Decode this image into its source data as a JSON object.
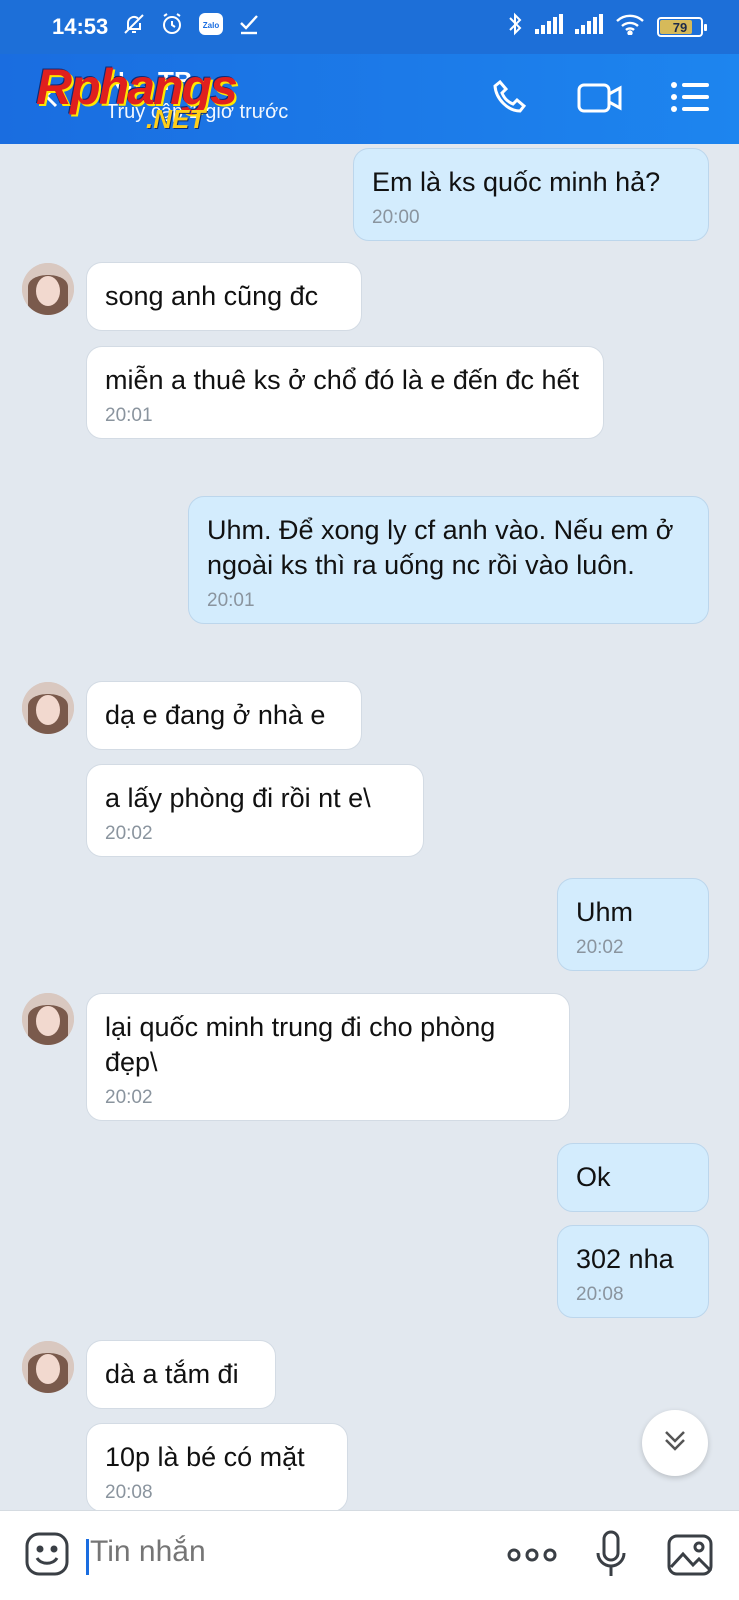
{
  "status_bar": {
    "time": "14:53",
    "battery": "79",
    "battery_level_percent": 79,
    "icons": [
      "bell-off-icon",
      "alarm-icon",
      "zalo-icon",
      "check-icon",
      "bluetooth-icon",
      "signal-icon",
      "signal-icon",
      "wifi-icon",
      "battery-icon"
    ]
  },
  "header": {
    "contact_name": "N… TB",
    "contact_status": "Truy cập 1 giờ trước",
    "watermark": "Rphangs",
    "watermark_suffix": ".NET",
    "icons": [
      "back-arrow-icon",
      "phone-icon",
      "video-call-icon",
      "menu-list-icon"
    ]
  },
  "messages": [
    {
      "side": "mine",
      "text": "Em là ks quốc minh hả?",
      "time": "20:00"
    },
    {
      "side": "theirs",
      "text": "song anh cũng đc",
      "time": ""
    },
    {
      "side": "theirs",
      "text": "miễn a thuê ks ở chổ đó là e đến đc hết",
      "time": "20:01"
    },
    {
      "side": "mine",
      "text": "Uhm. Để xong ly cf anh vào. Nếu em ở ngoài ks thì ra uống nc rồi vào luôn.",
      "time": "20:01"
    },
    {
      "side": "theirs",
      "text": "dạ e đang ở nhà e",
      "time": ""
    },
    {
      "side": "theirs",
      "text": "a lấy phòng đi rồi nt e\\",
      "time": "20:02"
    },
    {
      "side": "mine",
      "text": "Uhm",
      "time": "20:02"
    },
    {
      "side": "theirs",
      "text": "lại quốc minh trung đi cho phòng đẹp\\",
      "time": "20:02"
    },
    {
      "side": "mine",
      "text": "Ok",
      "time": ""
    },
    {
      "side": "mine",
      "text": "302 nha",
      "time": "20:08"
    },
    {
      "side": "theirs",
      "text": "dà a tắm đi",
      "time": ""
    },
    {
      "side": "theirs",
      "text": "10p là bé có mặt",
      "time": "20:08"
    }
  ],
  "composer": {
    "placeholder": "Tin nhắn",
    "icons": [
      "emoji-icon",
      "more-dots-icon",
      "microphone-icon",
      "photo-icon"
    ]
  },
  "colors": {
    "header_blue": "#1a6de0",
    "bubble_mine": "#d3ecfd",
    "bubble_theirs": "#ffffff",
    "chat_bg": "#e2e8ef"
  }
}
